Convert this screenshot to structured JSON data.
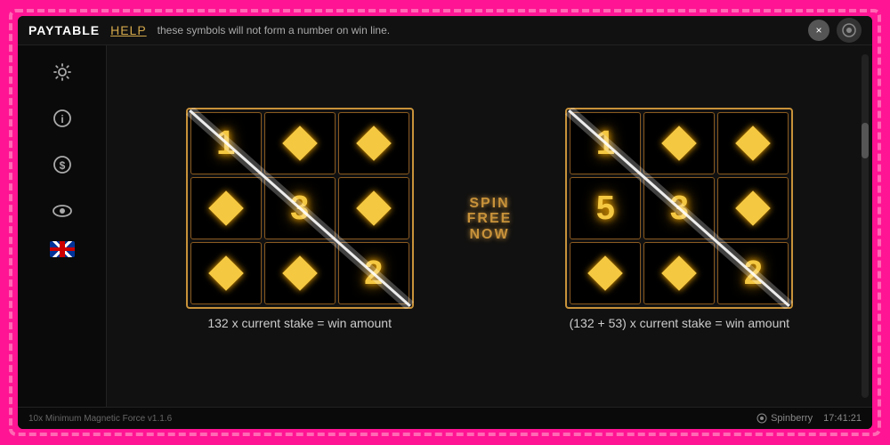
{
  "border": {
    "color": "#ff1493"
  },
  "header": {
    "paytable_label": "PAYTABLE",
    "help_label": "HELP",
    "subtitle": "these symbols will not form a number on win line.",
    "close_label": "×"
  },
  "sidebar": {
    "icons": [
      "gear",
      "info",
      "dollar",
      "eye",
      "flag"
    ]
  },
  "grids": [
    {
      "id": "grid-left",
      "cells": [
        {
          "type": "number",
          "value": "1"
        },
        {
          "type": "diamond"
        },
        {
          "type": "diamond"
        },
        {
          "type": "diamond"
        },
        {
          "type": "number",
          "value": "3"
        },
        {
          "type": "diamond"
        },
        {
          "type": "diamond"
        },
        {
          "type": "diamond"
        },
        {
          "type": "number",
          "value": "2"
        }
      ],
      "winline": "diagonal",
      "formula": "132 x current stake = win amount"
    },
    {
      "id": "grid-right",
      "cells": [
        {
          "type": "number",
          "value": "1"
        },
        {
          "type": "diamond"
        },
        {
          "type": "diamond"
        },
        {
          "type": "number",
          "value": "5"
        },
        {
          "type": "number",
          "value": "3"
        },
        {
          "type": "diamond"
        },
        {
          "type": "diamond"
        },
        {
          "type": "diamond"
        },
        {
          "type": "number",
          "value": "2"
        }
      ],
      "winline": "diagonal",
      "formula": "(132 + 53) x current stake = win amount"
    }
  ],
  "spin_free_now": {
    "lines": [
      "SPIN",
      "FREE",
      "NOW"
    ]
  },
  "bottom_bar": {
    "version": "10x Minimum Magnetic Force v1.1.6",
    "brand": "Spinberry",
    "time": "17:41:21"
  }
}
